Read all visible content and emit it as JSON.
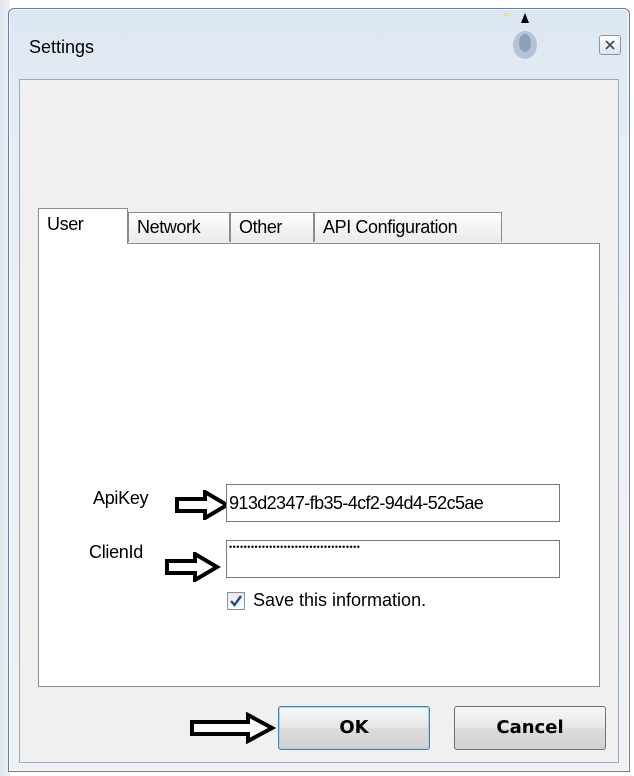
{
  "window": {
    "title": "Settings"
  },
  "tabs": [
    {
      "label": "User",
      "active": true
    },
    {
      "label": "Network",
      "active": false
    },
    {
      "label": "Other",
      "active": false
    },
    {
      "label": "API Configuration",
      "active": false
    }
  ],
  "user_tab": {
    "apikey_label": "ApiKey",
    "apikey_value": "913d2347-fb35-4cf2-94d4-52c5ae",
    "clientid_label": "ClienId",
    "clientid_value": "••••••••••••••••••••••••••••••••••••",
    "save_checked": true,
    "save_label": "Save this information."
  },
  "buttons": {
    "ok": "OK",
    "cancel": "Cancel"
  },
  "icons": {
    "close": "close-icon",
    "arrow": "outline-right-arrow-icon",
    "checkmark": "checkmark-icon"
  },
  "colors": {
    "accent": "#3c7fb1",
    "checkmark": "#1c4f8c"
  }
}
